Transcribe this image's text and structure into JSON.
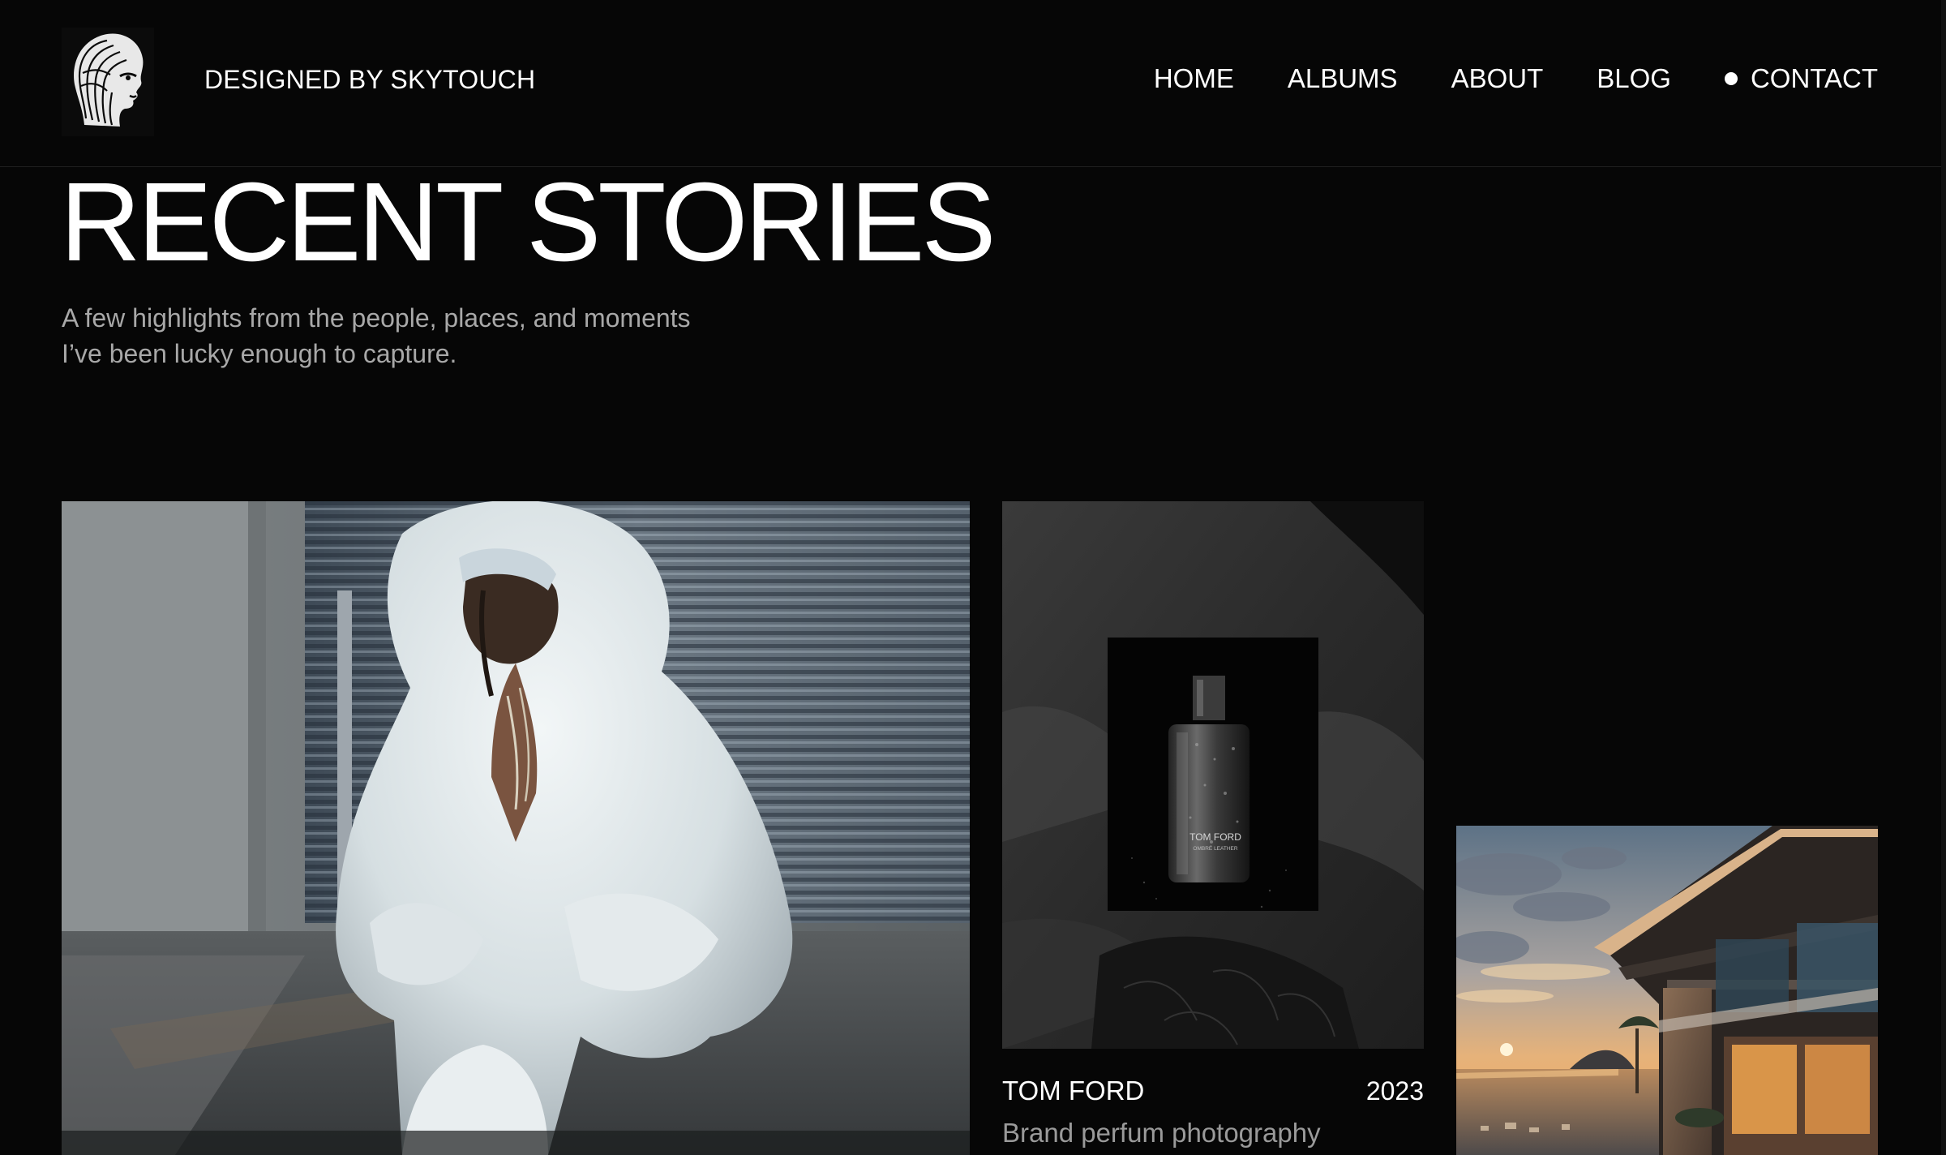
{
  "header": {
    "brand": "DESIGNED BY SKYTOUCH",
    "logo_icon": "engraved-head-icon",
    "nav": [
      {
        "label": "HOME"
      },
      {
        "label": "ALBUMS"
      },
      {
        "label": "ABOUT"
      },
      {
        "label": "BLOG"
      },
      {
        "label": "CONTACT",
        "indicator": "dot-icon"
      }
    ]
  },
  "hero": {
    "title": "RECENT STORIES",
    "subtitle_line1": "A few highlights from the people, places, and moments",
    "subtitle_line2": "I’ve been lucky enough to capture."
  },
  "stories": [
    {
      "image": "white fur coat portrait"
    },
    {
      "image": "perfume bottle still life",
      "bottle_label": "TOM FORD",
      "bottle_sublabel": "OMBRÉ LEATHER",
      "title": "TOM FORD",
      "year": "2023",
      "description": "Brand perfum photography"
    },
    {
      "image": "sunset villa architecture"
    }
  ],
  "colors": {
    "background": "#060606",
    "text": "#ffffff",
    "muted": "#a8a8a8"
  }
}
